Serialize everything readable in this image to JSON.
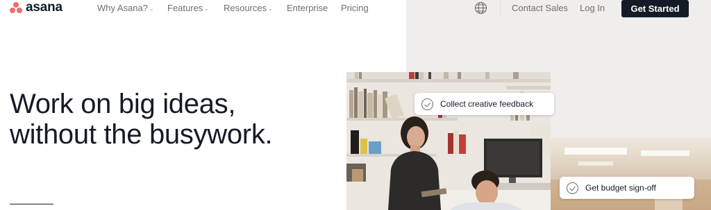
{
  "brand": {
    "name": "asana",
    "logo_color": "#f06a6a"
  },
  "nav": {
    "items": [
      {
        "label": "Why Asana?",
        "dropdown": true
      },
      {
        "label": "Features",
        "dropdown": true
      },
      {
        "label": "Resources",
        "dropdown": true
      },
      {
        "label": "Enterprise",
        "dropdown": false
      },
      {
        "label": "Pricing",
        "dropdown": false
      }
    ],
    "language_icon": "globe-icon",
    "contact_sales": "Contact Sales",
    "log_in": "Log In",
    "get_started": "Get Started"
  },
  "hero": {
    "headline_line1": "Work on big ideas,",
    "headline_line2": "without the busywork."
  },
  "chips": {
    "collect_feedback": "Collect creative feedback",
    "budget_signoff": "Get budget sign-off"
  },
  "colors": {
    "text_dark": "#151b26",
    "nav_text": "#6d6e6f",
    "panel_bg": "#f0eded",
    "cta_bg": "#151b26"
  }
}
